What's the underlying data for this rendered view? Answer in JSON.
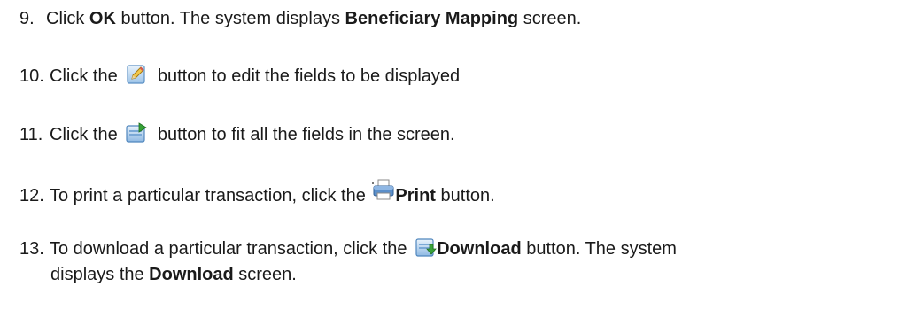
{
  "steps": [
    {
      "num": "9.",
      "t1": "Click ",
      "b1": "OK",
      "t2": " button. The system displays ",
      "b2": "Beneficiary Mapping",
      "t3": " screen."
    },
    {
      "num": "10.",
      "t1": "Click the",
      "icon": "edit-icon",
      "t2": "button to edit the fields to be displayed"
    },
    {
      "num": "11.",
      "t1": "Click the",
      "icon": "fit-screen-icon",
      "t2": "button to fit all the fields in the screen."
    },
    {
      "num": "12.",
      "t1": "To print a particular transaction, click the ",
      "icon": "printer-icon",
      "b1": "Print",
      "t2": " button."
    },
    {
      "num": "13.",
      "t1": "To download a particular transaction, click the ",
      "icon": "download-icon",
      "b1": "Download",
      "t2": " button. The system",
      "t3": "displays the ",
      "b2": "Download",
      "t4": " screen."
    }
  ]
}
